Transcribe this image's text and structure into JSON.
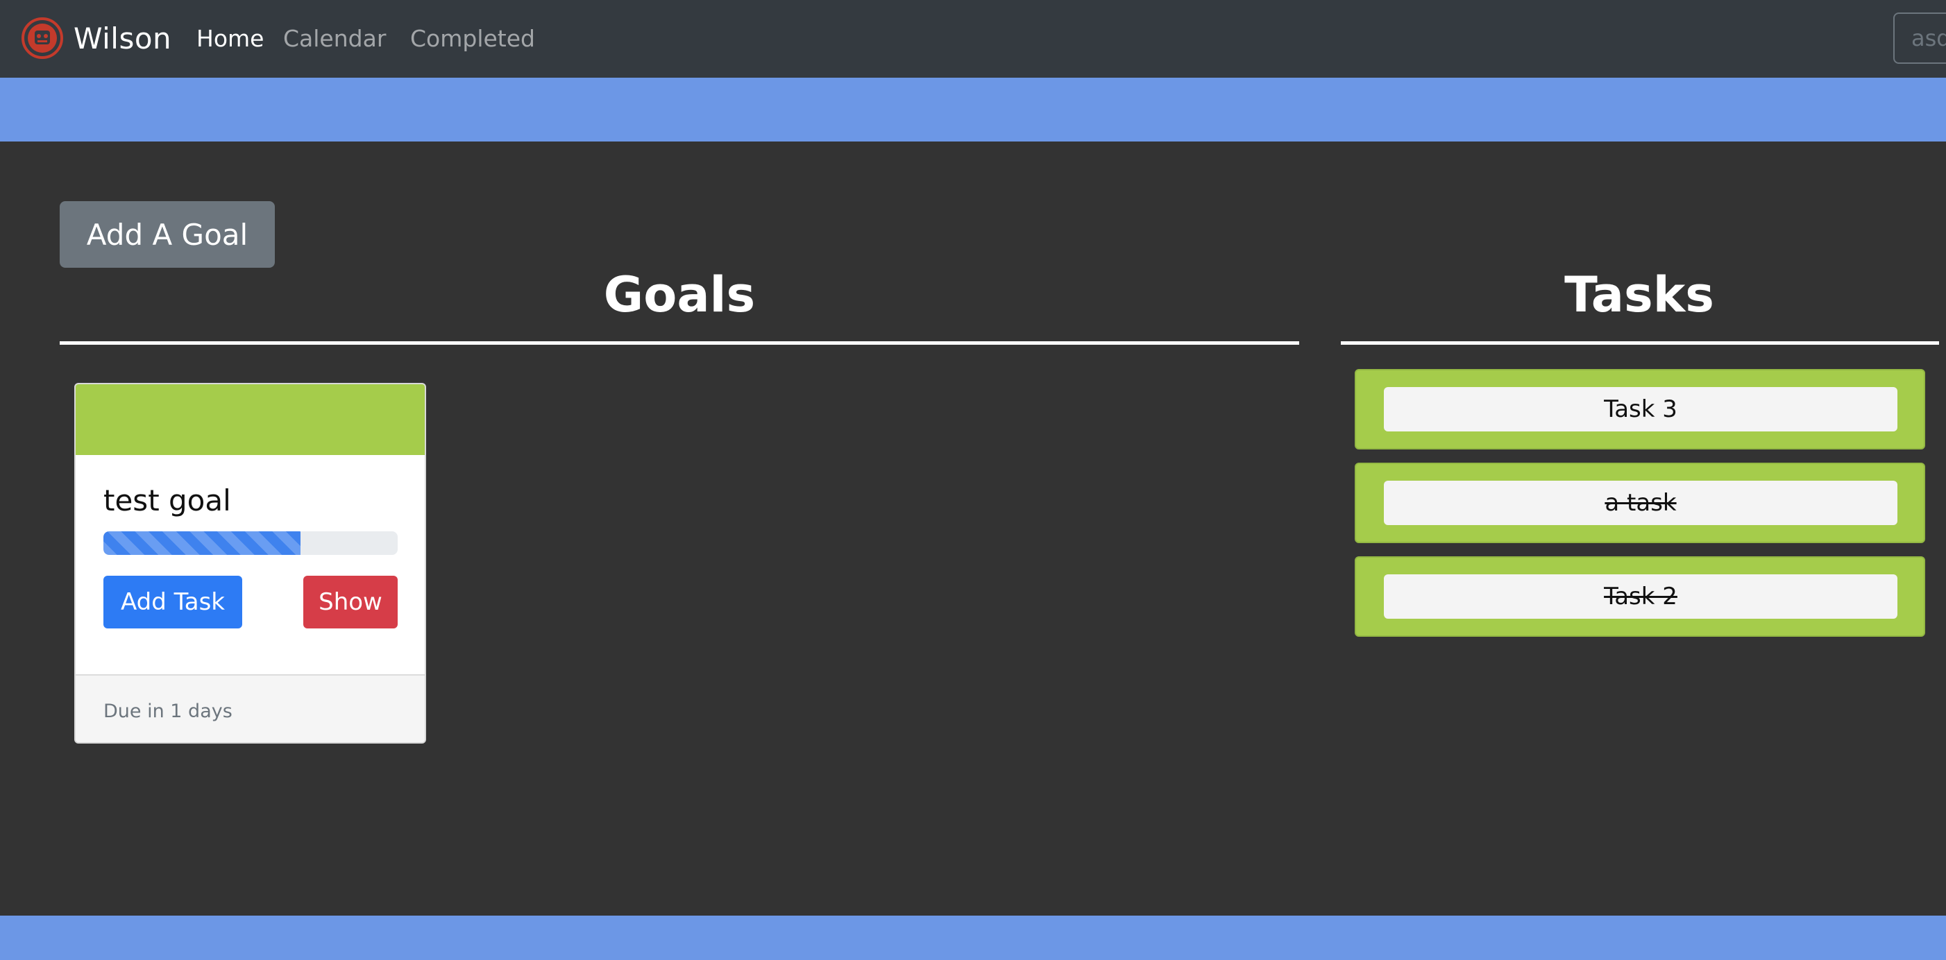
{
  "navbar": {
    "brand": "Wilson",
    "links": [
      {
        "label": "Home",
        "active": true
      },
      {
        "label": "Calendar",
        "active": false
      },
      {
        "label": "Completed",
        "active": false
      }
    ],
    "search_value": "asd"
  },
  "main": {
    "add_goal_label": "Add A Goal",
    "goals_title": "Goals",
    "tasks_title": "Tasks"
  },
  "goals": [
    {
      "title": "test goal",
      "progress_fraction": 0.67,
      "add_task_label": "Add Task",
      "show_label": "Show",
      "due_text": "Due in 1 days"
    }
  ],
  "tasks": [
    {
      "label": "Task 3",
      "completed": false
    },
    {
      "label": "a task",
      "completed": true
    },
    {
      "label": "Task 2",
      "completed": true
    }
  ],
  "colors": {
    "navbar": "#343a40",
    "band": "#6c97e6",
    "page_bg": "#333333",
    "goal_header": "#a5cc4b",
    "task_bg": "#a5cc4b",
    "primary": "#2d7bf4",
    "danger": "#d63d48",
    "secondary": "#6c757d"
  }
}
